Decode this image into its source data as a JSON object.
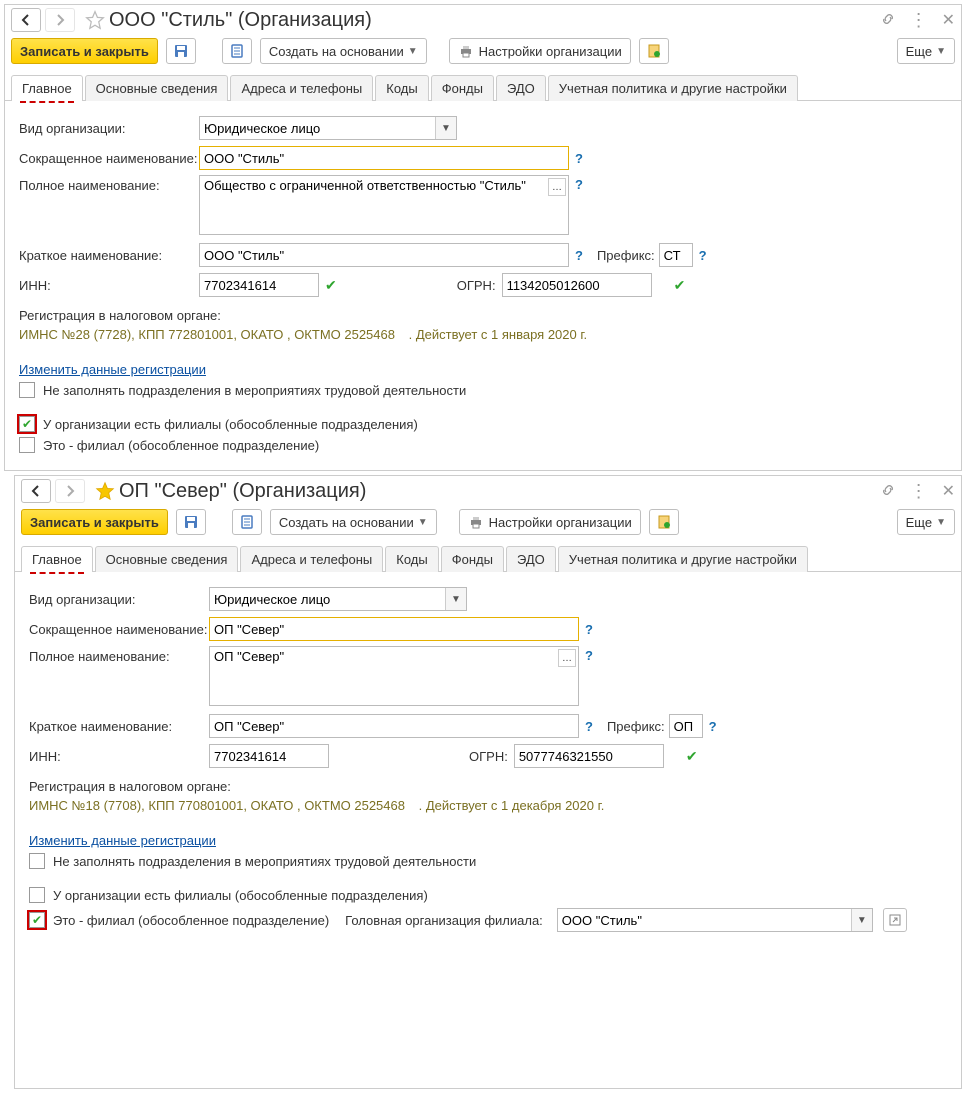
{
  "tabs": [
    "Главное",
    "Основные сведения",
    "Адреса и телефоны",
    "Коды",
    "Фонды",
    "ЭДО",
    "Учетная политика и другие настройки"
  ],
  "labels": {
    "org_type": "Вид организации:",
    "short_name": "Сокращенное наименование:",
    "full_name": "Полное наименование:",
    "brief_name": "Краткое наименование:",
    "prefix": "Префикс:",
    "inn": "ИНН:",
    "ogrn": "ОГРН:",
    "tax_reg": "Регистрация в налоговом органе:",
    "change_reg": "Изменить данные регистрации",
    "cb_no_fill": "Не заполнять подразделения в мероприятиях трудовой деятельности",
    "cb_has_branches": "У организации есть филиалы (обособленные подразделения)",
    "cb_is_branch": "Это - филиал (обособленное подразделение)",
    "head_org": "Головная организация филиала:"
  },
  "toolbar": {
    "save_close": "Записать и закрыть",
    "create_based": "Создать на основании",
    "org_settings": "Настройки организации",
    "more": "Еще"
  },
  "common": {
    "org_type_value": "Юридическое лицо"
  },
  "top": {
    "title": "ООО \"Стиль\" (Организация)",
    "short_name": "ООО \"Стиль\"",
    "full_name": "Общество с ограниченной ответственностью \"Стиль\"",
    "brief_name": "ООО \"Стиль\"",
    "prefix": "СТ",
    "inn": "7702341614",
    "ogrn": "1134205012600",
    "tax_info": "ИМНС №28 (7728), КПП 772801001, ОКАТО , ОКТМО 2525468",
    "tax_valid": ". Действует с 1 января 2020 г.",
    "has_branches": true,
    "is_branch": false
  },
  "bottom": {
    "title": "ОП \"Север\" (Организация)",
    "short_name": "ОП \"Север\"",
    "full_name": "ОП \"Север\"",
    "brief_name": "ОП \"Север\"",
    "prefix": "ОП",
    "inn": "7702341614",
    "ogrn": "5077746321550",
    "tax_info": "ИМНС №18 (7708), КПП 770801001, ОКАТО , ОКТМО 2525468",
    "tax_valid": ". Действует с 1 декабря 2020 г.",
    "has_branches": false,
    "is_branch": true,
    "head_org_value": "ООО \"Стиль\""
  }
}
